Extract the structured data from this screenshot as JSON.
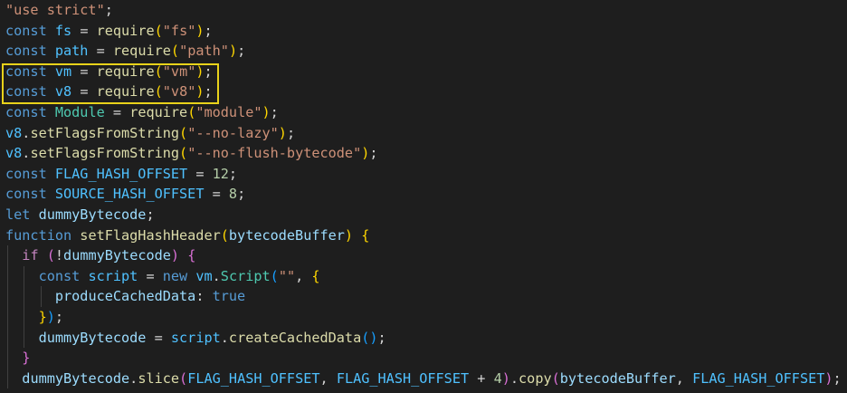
{
  "editor": {
    "theme": "dark",
    "highlight_color": "#e8d21a",
    "lines": [
      [
        {
          "t": "\"use strict\"",
          "c": "str"
        },
        {
          "t": ";",
          "c": "p"
        }
      ],
      [
        {
          "t": "const ",
          "c": "kw"
        },
        {
          "t": "fs",
          "c": "const"
        },
        {
          "t": " = ",
          "c": "p"
        },
        {
          "t": "require",
          "c": "fn"
        },
        {
          "t": "(",
          "c": "b1"
        },
        {
          "t": "\"fs\"",
          "c": "str"
        },
        {
          "t": ")",
          "c": "b1"
        },
        {
          "t": ";",
          "c": "p"
        }
      ],
      [
        {
          "t": "const ",
          "c": "kw"
        },
        {
          "t": "path",
          "c": "const"
        },
        {
          "t": " = ",
          "c": "p"
        },
        {
          "t": "require",
          "c": "fn"
        },
        {
          "t": "(",
          "c": "b1"
        },
        {
          "t": "\"path\"",
          "c": "str"
        },
        {
          "t": ")",
          "c": "b1"
        },
        {
          "t": ";",
          "c": "p"
        }
      ],
      [
        {
          "t": "const ",
          "c": "kw"
        },
        {
          "t": "vm",
          "c": "const"
        },
        {
          "t": " = ",
          "c": "p"
        },
        {
          "t": "require",
          "c": "fn"
        },
        {
          "t": "(",
          "c": "b1"
        },
        {
          "t": "\"vm\"",
          "c": "str"
        },
        {
          "t": ")",
          "c": "b1"
        },
        {
          "t": ";",
          "c": "p"
        }
      ],
      [
        {
          "t": "const ",
          "c": "kw"
        },
        {
          "t": "v8",
          "c": "const"
        },
        {
          "t": " = ",
          "c": "p"
        },
        {
          "t": "require",
          "c": "fn"
        },
        {
          "t": "(",
          "c": "b1"
        },
        {
          "t": "\"v8\"",
          "c": "str"
        },
        {
          "t": ")",
          "c": "b1"
        },
        {
          "t": ";",
          "c": "p"
        }
      ],
      [
        {
          "t": "const ",
          "c": "kw"
        },
        {
          "t": "Module",
          "c": "cls"
        },
        {
          "t": " = ",
          "c": "p"
        },
        {
          "t": "require",
          "c": "fn"
        },
        {
          "t": "(",
          "c": "b1"
        },
        {
          "t": "\"module\"",
          "c": "str"
        },
        {
          "t": ")",
          "c": "b1"
        },
        {
          "t": ";",
          "c": "p"
        }
      ],
      [
        {
          "t": "v8",
          "c": "const"
        },
        {
          "t": ".",
          "c": "p"
        },
        {
          "t": "setFlagsFromString",
          "c": "fn"
        },
        {
          "t": "(",
          "c": "b1"
        },
        {
          "t": "\"--no-lazy\"",
          "c": "str"
        },
        {
          "t": ")",
          "c": "b1"
        },
        {
          "t": ";",
          "c": "p"
        }
      ],
      [
        {
          "t": "v8",
          "c": "const"
        },
        {
          "t": ".",
          "c": "p"
        },
        {
          "t": "setFlagsFromString",
          "c": "fn"
        },
        {
          "t": "(",
          "c": "b1"
        },
        {
          "t": "\"--no-flush-bytecode\"",
          "c": "str"
        },
        {
          "t": ")",
          "c": "b1"
        },
        {
          "t": ";",
          "c": "p"
        }
      ],
      [
        {
          "t": "const ",
          "c": "kw"
        },
        {
          "t": "FLAG_HASH_OFFSET",
          "c": "const"
        },
        {
          "t": " = ",
          "c": "p"
        },
        {
          "t": "12",
          "c": "num"
        },
        {
          "t": ";",
          "c": "p"
        }
      ],
      [
        {
          "t": "const ",
          "c": "kw"
        },
        {
          "t": "SOURCE_HASH_OFFSET",
          "c": "const"
        },
        {
          "t": " = ",
          "c": "p"
        },
        {
          "t": "8",
          "c": "num"
        },
        {
          "t": ";",
          "c": "p"
        }
      ],
      [
        {
          "t": "let ",
          "c": "kw"
        },
        {
          "t": "dummyBytecode",
          "c": "var"
        },
        {
          "t": ";",
          "c": "p"
        }
      ],
      [
        {
          "t": "function ",
          "c": "kw"
        },
        {
          "t": "setFlagHashHeader",
          "c": "fn"
        },
        {
          "t": "(",
          "c": "b1"
        },
        {
          "t": "bytecodeBuffer",
          "c": "var"
        },
        {
          "t": ")",
          "c": "b1"
        },
        {
          "t": " ",
          "c": "p"
        },
        {
          "t": "{",
          "c": "b1"
        }
      ],
      [
        {
          "t": "  ",
          "c": "p"
        },
        {
          "t": "if ",
          "c": "ctl"
        },
        {
          "t": "(",
          "c": "b2"
        },
        {
          "t": "!",
          "c": "p"
        },
        {
          "t": "dummyBytecode",
          "c": "var"
        },
        {
          "t": ")",
          "c": "b2"
        },
        {
          "t": " ",
          "c": "p"
        },
        {
          "t": "{",
          "c": "b2"
        }
      ],
      [
        {
          "t": "    ",
          "c": "p"
        },
        {
          "t": "const ",
          "c": "kw"
        },
        {
          "t": "script",
          "c": "const"
        },
        {
          "t": " = ",
          "c": "p"
        },
        {
          "t": "new ",
          "c": "kw"
        },
        {
          "t": "vm",
          "c": "const"
        },
        {
          "t": ".",
          "c": "p"
        },
        {
          "t": "Script",
          "c": "cls"
        },
        {
          "t": "(",
          "c": "b3"
        },
        {
          "t": "\"\"",
          "c": "str"
        },
        {
          "t": ", ",
          "c": "p"
        },
        {
          "t": "{",
          "c": "b1"
        }
      ],
      [
        {
          "t": "      ",
          "c": "p"
        },
        {
          "t": "produceCachedData",
          "c": "var"
        },
        {
          "t": ": ",
          "c": "p"
        },
        {
          "t": "true",
          "c": "kw"
        }
      ],
      [
        {
          "t": "    ",
          "c": "p"
        },
        {
          "t": "}",
          "c": "b1"
        },
        {
          "t": ")",
          "c": "b3"
        },
        {
          "t": ";",
          "c": "p"
        }
      ],
      [
        {
          "t": "    ",
          "c": "p"
        },
        {
          "t": "dummyBytecode",
          "c": "var"
        },
        {
          "t": " = ",
          "c": "p"
        },
        {
          "t": "script",
          "c": "const"
        },
        {
          "t": ".",
          "c": "p"
        },
        {
          "t": "createCachedData",
          "c": "fn"
        },
        {
          "t": "(",
          "c": "b3"
        },
        {
          "t": ")",
          "c": "b3"
        },
        {
          "t": ";",
          "c": "p"
        }
      ],
      [
        {
          "t": "  ",
          "c": "p"
        },
        {
          "t": "}",
          "c": "b2"
        }
      ],
      [
        {
          "t": "  ",
          "c": "p"
        },
        {
          "t": "dummyBytecode",
          "c": "var"
        },
        {
          "t": ".",
          "c": "p"
        },
        {
          "t": "slice",
          "c": "fn"
        },
        {
          "t": "(",
          "c": "b2"
        },
        {
          "t": "FLAG_HASH_OFFSET",
          "c": "const"
        },
        {
          "t": ", ",
          "c": "p"
        },
        {
          "t": "FLAG_HASH_OFFSET",
          "c": "const"
        },
        {
          "t": " + ",
          "c": "p"
        },
        {
          "t": "4",
          "c": "num"
        },
        {
          "t": ")",
          "c": "b2"
        },
        {
          "t": ".",
          "c": "p"
        },
        {
          "t": "copy",
          "c": "fn"
        },
        {
          "t": "(",
          "c": "b2"
        },
        {
          "t": "bytecodeBuffer",
          "c": "var"
        },
        {
          "t": ", ",
          "c": "p"
        },
        {
          "t": "FLAG_HASH_OFFSET",
          "c": "const"
        },
        {
          "t": ")",
          "c": "b2"
        },
        {
          "t": ";",
          "c": "p"
        }
      ]
    ]
  }
}
